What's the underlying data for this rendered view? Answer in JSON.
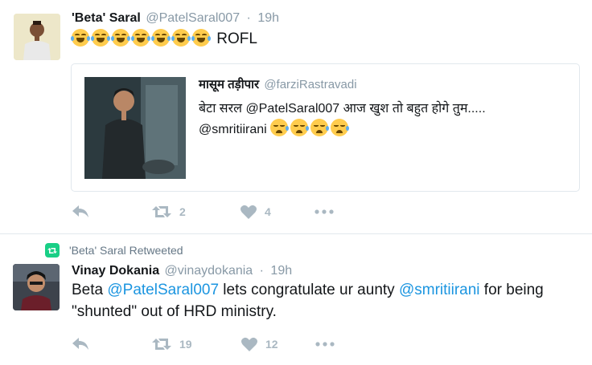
{
  "tweets": [
    {
      "author": {
        "name": "'Beta' Saral",
        "handle": "@PatelSaral007"
      },
      "time": "19h",
      "text": "ROFL",
      "emoji_before_text": "face-with-tears-of-joy",
      "emoji_count": 7,
      "quoted": {
        "author": {
          "name": "मासूम तड़ीपार",
          "handle": "@farziRastravadi"
        },
        "line1": "बेटा सरल @PatelSaral007 आज खुश तो बहुत होगे तुम.....",
        "line2_mention": "@smritiirani",
        "line2_emoji": "crying-face",
        "line2_emoji_count": 4
      },
      "actions": {
        "reply": "",
        "retweet": "2",
        "like": "4"
      }
    },
    {
      "context": "'Beta' Saral Retweeted",
      "author": {
        "name": "Vinay Dokania",
        "handle": "@vinaydokania"
      },
      "time": "19h",
      "text_parts": [
        "Beta ",
        "@PatelSaral007",
        " lets congratulate ur aunty ",
        "@smritiirani",
        " for being \"shunted\" out of HRD ministry."
      ],
      "actions": {
        "reply": "",
        "retweet": "19",
        "like": "12"
      }
    }
  ],
  "colors": {
    "link": "#1b95e0",
    "muted": "#8899a6",
    "icon": "#aab8c2",
    "retweet_green": "#19cf86"
  }
}
